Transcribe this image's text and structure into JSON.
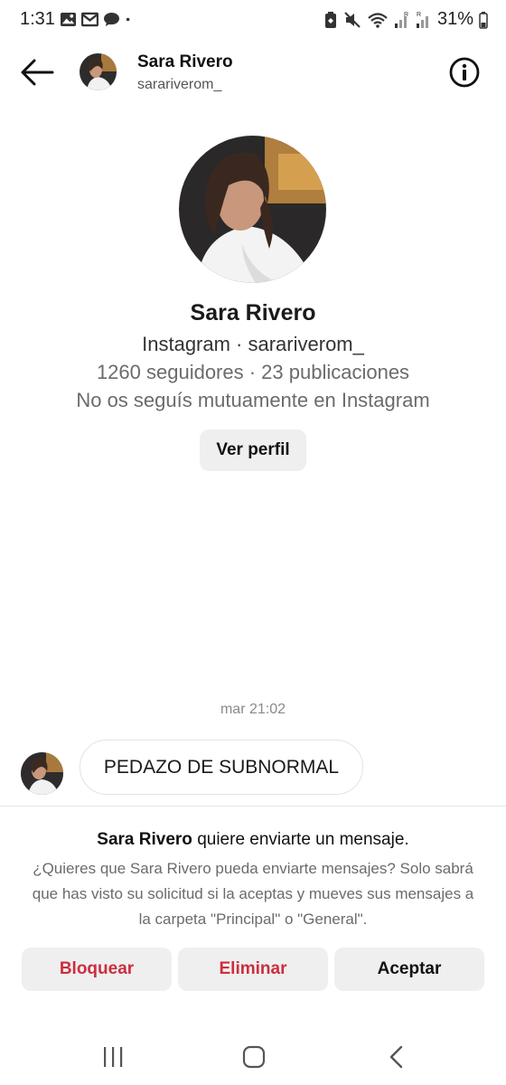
{
  "status_bar": {
    "time": "1:31",
    "battery": "31%",
    "left_icons": [
      "image-icon",
      "gmail-icon",
      "chat-bubble-icon",
      "dot-icon"
    ],
    "right_icons": [
      "battery-saver-icon",
      "mute-icon",
      "wifi-icon",
      "signal-icon",
      "signal-icon-2",
      "battery-icon"
    ]
  },
  "header": {
    "name": "Sara Rivero",
    "username": "sarariverom_"
  },
  "profile": {
    "name": "Sara Rivero",
    "platform_line": "Instagram · sarariverom_",
    "stats_line": "1260 seguidores · 23 publicaciones",
    "mutual_line": "No os seguís mutuamente en Instagram",
    "view_profile_label": "Ver perfil"
  },
  "conversation": {
    "timestamp": "mar 21:02",
    "messages": [
      {
        "text": "PEDAZO DE SUBNORMAL"
      }
    ]
  },
  "request": {
    "title_name": "Sara Rivero",
    "title_rest": " quiere enviarte un mensaje.",
    "description": "¿Quieres que Sara Rivero pueda enviarte mensajes? Solo sabrá que has visto su solicitud si la aceptas y mueves sus mensajes a la carpeta \"Principal\" o \"General\".",
    "buttons": {
      "block": "Bloquear",
      "delete": "Eliminar",
      "accept": "Aceptar"
    }
  },
  "colors": {
    "destructive": "#cc2e3f",
    "button_bg": "#efefef",
    "secondary_text": "#6b6b6b"
  },
  "nav_icons": [
    "recent-apps-icon",
    "home-icon",
    "back-nav-icon"
  ]
}
